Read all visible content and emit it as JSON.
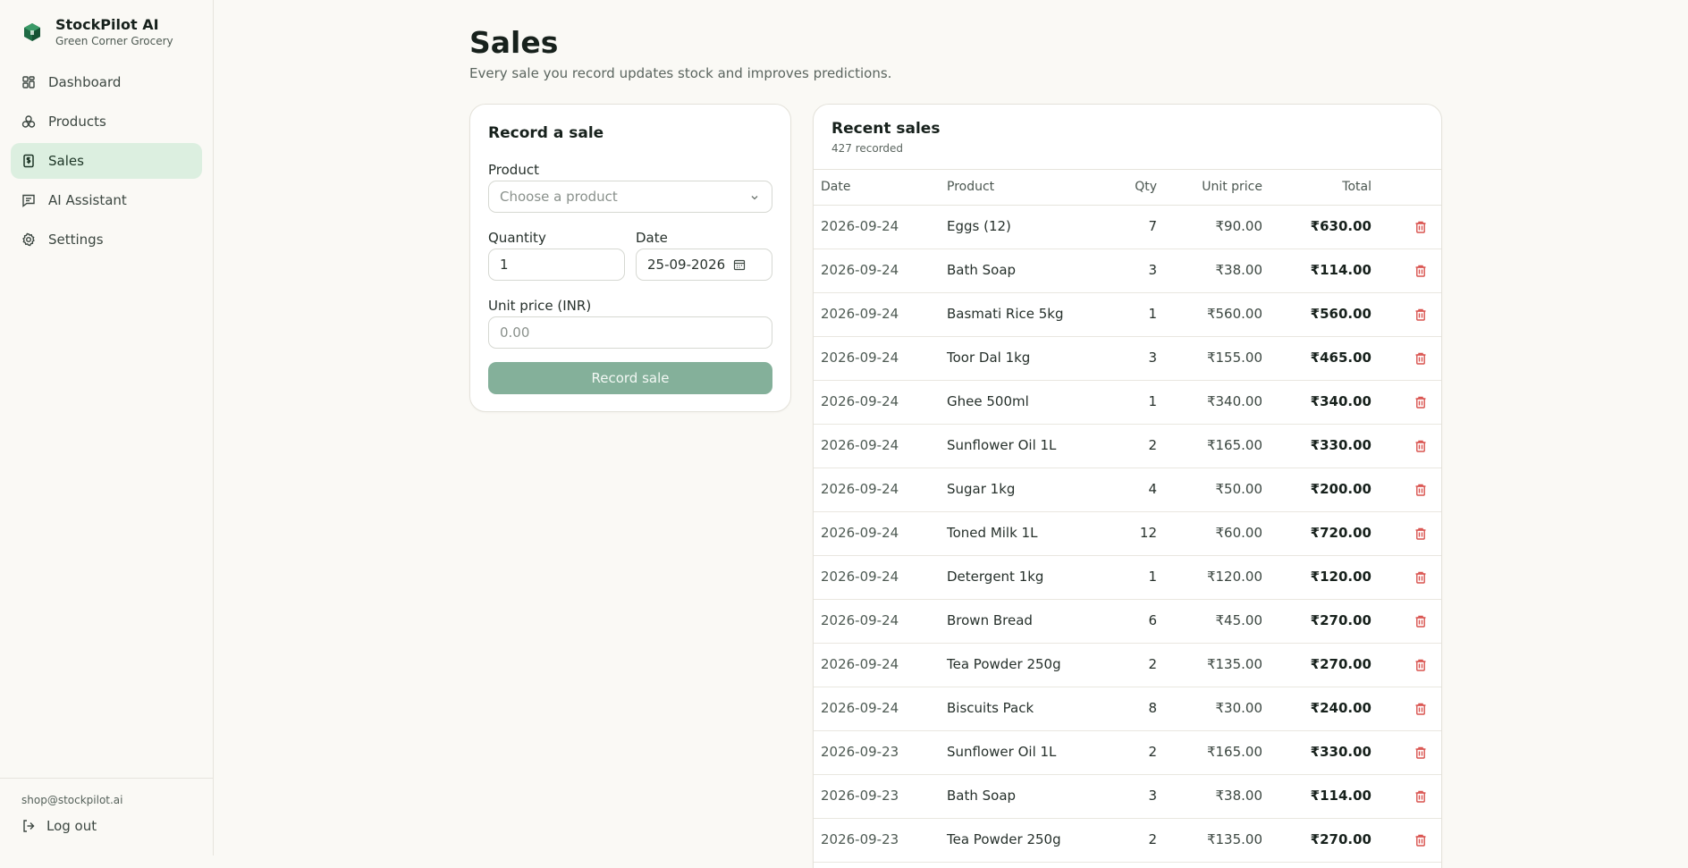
{
  "app": {
    "name": "StockPilot AI",
    "store": "Green Corner Grocery"
  },
  "sidebar": {
    "items": [
      {
        "label": "Dashboard",
        "icon": "grid-icon"
      },
      {
        "label": "Products",
        "icon": "boxes-icon"
      },
      {
        "label": "Sales",
        "icon": "receipt-icon",
        "active": true
      },
      {
        "label": "AI Assistant",
        "icon": "chat-icon"
      },
      {
        "label": "Settings",
        "icon": "gear-icon"
      }
    ],
    "email": "shop@stockpilot.ai",
    "logout_label": "Log out"
  },
  "page": {
    "title": "Sales",
    "subtitle": "Every sale you record updates stock and improves predictions."
  },
  "form": {
    "title": "Record a sale",
    "product_label": "Product",
    "product_placeholder": "Choose a product",
    "quantity_label": "Quantity",
    "quantity_value": "1",
    "date_label": "Date",
    "date_value": "25-09-2026",
    "unit_price_label": "Unit price (INR)",
    "unit_price_placeholder": "0.00",
    "submit_label": "Record sale"
  },
  "recent": {
    "title": "Recent sales",
    "count": "427 recorded",
    "columns": {
      "date": "Date",
      "product": "Product",
      "qty": "Qty",
      "unit_price": "Unit price",
      "total": "Total"
    },
    "rows": [
      {
        "date": "2026-09-24",
        "product": "Eggs (12)",
        "qty": "7",
        "unit": "₹90.00",
        "total": "₹630.00"
      },
      {
        "date": "2026-09-24",
        "product": "Bath Soap",
        "qty": "3",
        "unit": "₹38.00",
        "total": "₹114.00"
      },
      {
        "date": "2026-09-24",
        "product": "Basmati Rice 5kg",
        "qty": "1",
        "unit": "₹560.00",
        "total": "₹560.00"
      },
      {
        "date": "2026-09-24",
        "product": "Toor Dal 1kg",
        "qty": "3",
        "unit": "₹155.00",
        "total": "₹465.00"
      },
      {
        "date": "2026-09-24",
        "product": "Ghee 500ml",
        "qty": "1",
        "unit": "₹340.00",
        "total": "₹340.00"
      },
      {
        "date": "2026-09-24",
        "product": "Sunflower Oil 1L",
        "qty": "2",
        "unit": "₹165.00",
        "total": "₹330.00"
      },
      {
        "date": "2026-09-24",
        "product": "Sugar 1kg",
        "qty": "4",
        "unit": "₹50.00",
        "total": "₹200.00"
      },
      {
        "date": "2026-09-24",
        "product": "Toned Milk 1L",
        "qty": "12",
        "unit": "₹60.00",
        "total": "₹720.00"
      },
      {
        "date": "2026-09-24",
        "product": "Detergent 1kg",
        "qty": "1",
        "unit": "₹120.00",
        "total": "₹120.00"
      },
      {
        "date": "2026-09-24",
        "product": "Brown Bread",
        "qty": "6",
        "unit": "₹45.00",
        "total": "₹270.00"
      },
      {
        "date": "2026-09-24",
        "product": "Tea Powder 250g",
        "qty": "2",
        "unit": "₹135.00",
        "total": "₹270.00"
      },
      {
        "date": "2026-09-24",
        "product": "Biscuits Pack",
        "qty": "8",
        "unit": "₹30.00",
        "total": "₹240.00"
      },
      {
        "date": "2026-09-23",
        "product": "Sunflower Oil 1L",
        "qty": "2",
        "unit": "₹165.00",
        "total": "₹330.00"
      },
      {
        "date": "2026-09-23",
        "product": "Bath Soap",
        "qty": "3",
        "unit": "₹38.00",
        "total": "₹114.00"
      },
      {
        "date": "2026-09-23",
        "product": "Tea Powder 250g",
        "qty": "2",
        "unit": "₹135.00",
        "total": "₹270.00"
      }
    ]
  },
  "colors": {
    "accent": "#1f6b45",
    "active_bg": "#dcefe0",
    "button": "#84b09a",
    "delete": "#d9534f"
  }
}
